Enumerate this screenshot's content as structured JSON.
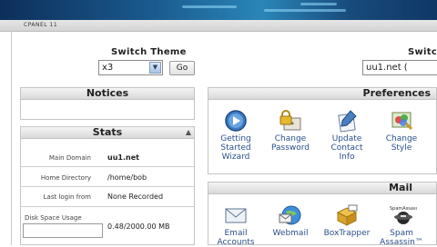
{
  "header": {
    "brand": "CPANEL 11"
  },
  "theme_switch": {
    "title": "Switch Theme",
    "selected": "x3",
    "go_label": "Go"
  },
  "right_switch": {
    "title": "Switc",
    "selected": "uu1.net ("
  },
  "notices": {
    "title": "Notices"
  },
  "stats": {
    "title": "Stats",
    "rows": [
      {
        "label": "Main Domain",
        "value": "uu1.net"
      },
      {
        "label": "Home Directory",
        "value": "/home/bob"
      },
      {
        "label": "Last login from",
        "value": "None Recorded"
      },
      {
        "label": "Disk Space Usage",
        "value": "0.48/2000.00 MB"
      }
    ]
  },
  "preferences": {
    "title": "Preferences",
    "items": [
      {
        "label": "Getting Started Wizard",
        "icon": "wizard-icon"
      },
      {
        "label": "Change Password",
        "icon": "password-lock-icon"
      },
      {
        "label": "Update Contact Info",
        "icon": "contact-info-icon"
      },
      {
        "label": "Change Style",
        "icon": "style-icon"
      }
    ]
  },
  "mail": {
    "title": "Mail",
    "items": [
      {
        "label": "Email Accounts",
        "icon": "envelope-icon"
      },
      {
        "label": "Webmail",
        "icon": "webmail-globe-icon"
      },
      {
        "label": "BoxTrapper",
        "icon": "boxtrapper-icon"
      },
      {
        "label": "Spam Assassin™",
        "icon": "spamassassin-icon"
      }
    ],
    "spam_logo_text": "SpamAssassin"
  }
}
